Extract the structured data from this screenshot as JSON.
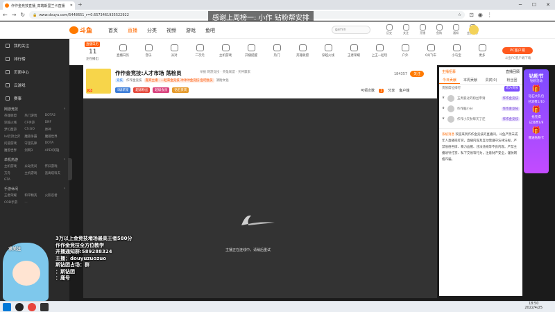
{
  "browser": {
    "tab_title": "作作金竞技直播_高端斯里兰卡直播",
    "address": "www.douyu.com/5448651_r=0.6573461935522922",
    "controls": {
      "min": "─",
      "max": "☐",
      "close": "✕"
    }
  },
  "banner": "感谢上周榜一: 小作     钻粉帮安排",
  "site": {
    "logo": "斗鱼",
    "nav": [
      "首页",
      "直播",
      "分类",
      "视频",
      "游戏",
      "鱼吧"
    ],
    "nav_active": 1,
    "search_placeholder": "gamin",
    "header_icons": [
      "历史",
      "关注",
      "开播",
      "鱼购",
      "通知",
      "会员中心"
    ]
  },
  "sidebar": {
    "top_items": [
      "我的关注",
      "排行榜",
      "页面中心",
      "云游戏",
      "赛事"
    ],
    "sections": [
      {
        "title": "网游竞技",
        "items": [
          "英雄联盟",
          "热门游戏",
          "DOTA2",
          "穿越火线",
          "CF手游",
          "DNF",
          "梦幻西游",
          "CS:GO",
          "原神",
          "lol云顶之弈",
          "魔兽争霸",
          "魔兽世界",
          "问道游戏",
          "守望先锋",
          "DOTA",
          "魔兽世界",
          "剑网3",
          "APEX英雄"
        ]
      },
      {
        "title": "单机热游",
        "items": [
          "主机游戏",
          "永劫无间",
          "怀旧游戏",
          "方舟",
          "主机游戏",
          "逃离塔科夫",
          "GTA"
        ]
      },
      {
        "title": "手游休闲",
        "items": [
          "王者荣耀",
          "和平精英",
          "火影忍者",
          "COD手游",
          "..."
        ]
      }
    ]
  },
  "categories": {
    "hot_label": "直播日历",
    "day": "11",
    "day_label": "正在播出",
    "items": [
      "直播日历",
      "音乐",
      "派对",
      "二次元",
      "主机游戏",
      "开播提醒",
      "热门",
      "英雄联盟",
      "穿越火线",
      "王者荣耀",
      "上王一起玩",
      "户外",
      "QQ飞车",
      "小马宝",
      "更多"
    ]
  },
  "pc_client": {
    "label": "PC客户端",
    "sub": "斗鱼PC客户端下载"
  },
  "room": {
    "title": "作作金竞技:人才市场 荡检员",
    "meta": "举报  网游竞技 · 英雄联盟 · 天神赢家",
    "tag1": "竞技",
    "tag2": "作作金竞技",
    "level": "26",
    "highlight": "嘉宾主播 · 一起来金竞技·冲冲冲金竞技·鱼吧会员",
    "extra": "消防文化",
    "badges": [
      "S级新宠",
      "超级粉丝",
      "超级会员",
      "钻石贵宾"
    ],
    "follow_count": "184357",
    "follow_label": "关注",
    "share_count": "可领次数",
    "share_num": "1",
    "share": "分享",
    "client": "客户端"
  },
  "video": {
    "message": "主播正在连线中，请稍后重试"
  },
  "overlay": {
    "lines": [
      "3万以上金竞技堵场最高王者580分",
      "作作金竞技全方位教学",
      "开播通知群:589288324",
      "主播：douyuzuozuo",
      "斯钻团占场：群",
      "：斯钻团",
      "：鹿号"
    ],
    "label": "求关注"
  },
  "right_panel": {
    "top": [
      "主播招募",
      "直播回顾"
    ],
    "tabs": [
      "今日贡献",
      "本周贡献",
      "贵宾(0)",
      "粉丝团"
    ],
    "notice_title": "贵族席位排行",
    "notice_action": "成为贵族",
    "ranks": [
      {
        "name": "五周爱过的粉丝申请",
        "badge": "作作金竞技"
      },
      {
        "name": "作作脑小分",
        "badge": "作作金竞技"
      },
      {
        "name": "作作小天秋每天了还",
        "badge": "作作金竞技"
      }
    ],
    "system_tag": "系统消息",
    "system_text": "欢迎来到作作金竞技的直播间。斗鱼严禁未成年人直播或打赏，直播内容及互动需遵守法律法规，严禁低俗色情、暴力血腥、违法违规等不良内容。严禁主播诱导打赏、私下交易等行为，注意财产安全，谨防网络诈骗。"
  },
  "promo": {
    "title": "钻粉节",
    "lines": [
      "钻粉活动",
      "钻石大礼包",
      "已消费1/10",
      "抢先得",
      "已消费1/8",
      "赠送钻粉卡"
    ]
  },
  "taskbar": {
    "time": "18:50",
    "date": "2022/4/25"
  }
}
